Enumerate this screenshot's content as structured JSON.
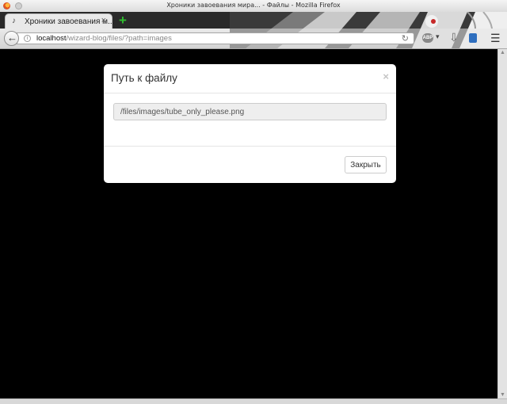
{
  "window": {
    "title": "Хроники завоевания мира... - Файлы - Mozilla Firefox"
  },
  "tab": {
    "title": "Хроники завоевания м...",
    "close_glyph": "×",
    "favicon_glyph": "♪"
  },
  "new_tab_glyph": "+",
  "urlbar": {
    "host": "localhost",
    "path": "/wizard-blog/files/?path=images",
    "info_glyph": "i",
    "reload_glyph": "↻"
  },
  "toolbar": {
    "abp_label": "ABP",
    "abp_dropdown_glyph": "▾",
    "download_glyph": "⇩",
    "menu_glyph": "☰"
  },
  "modal": {
    "title": "Путь к файлу",
    "close_glyph": "×",
    "path_value": "/files/images/tube_only_please.png",
    "close_button_label": "Закрыть"
  },
  "colors": {
    "page_background": "#000000",
    "modal_background": "#ffffff",
    "new_tab_green": "#2fbe2f"
  }
}
